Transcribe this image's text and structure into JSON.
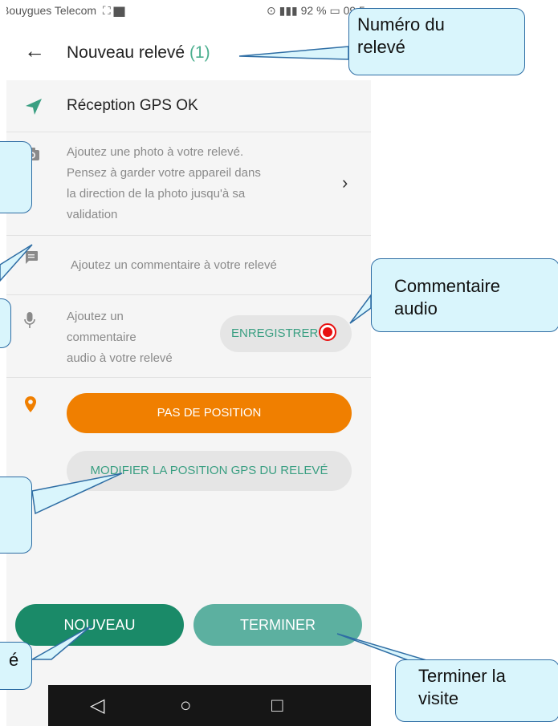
{
  "status_bar": {
    "carrier": "Bouygues Telecom",
    "battery": "92 %",
    "time": "09:5"
  },
  "header": {
    "title": "Nouveau relevé",
    "record_number": "(1)"
  },
  "gps": {
    "text": "Réception GPS OK"
  },
  "photo": {
    "lines": [
      "Ajoutez une photo à votre relevé.",
      "Pensez à garder votre appareil dans",
      "la direction de la photo jusqu'à sa",
      "validation"
    ]
  },
  "comment": {
    "text": "Ajoutez un commentaire à votre relevé"
  },
  "audio": {
    "lines": [
      "Ajoutez un",
      "commentaire",
      "audio à votre relevé"
    ],
    "record_label": "ENREGISTRER"
  },
  "position": {
    "no_position_label": "PAS DE POSITION",
    "modify_label": "MODIFIER LA POSITION GPS DU RELEVÉ"
  },
  "actions": {
    "new_label": "NOUVEAU",
    "finish_label": "TERMINER"
  },
  "callouts": {
    "record_number": [
      "Numéro du",
      "relevé"
    ],
    "audio_comment": [
      "Commentaire",
      "audio"
    ],
    "finish_visit": [
      "Terminer la",
      "visite"
    ],
    "partial_bottom": "é"
  },
  "colors": {
    "accent_green": "#3a9f82",
    "new_button": "#1a8a68",
    "finish_button": "#5cb0a0",
    "orange": "#f07f00",
    "record_red": "#e81010",
    "callout_fill": "#d9f5fc",
    "callout_border": "#2e6da4"
  }
}
